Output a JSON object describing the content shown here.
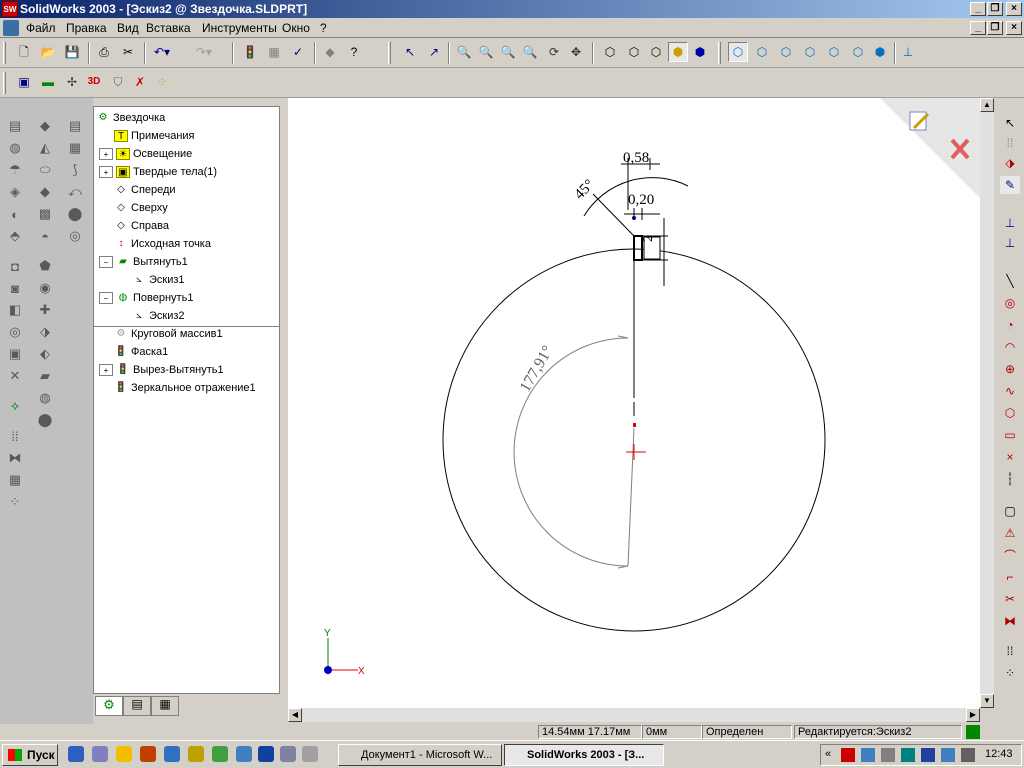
{
  "app": {
    "title": "SolidWorks 2003 - [Эскиз2 @ Звездочка.SLDPRT]",
    "icon_text": "SW"
  },
  "menu": [
    "Файл",
    "Правка",
    "Вид",
    "Вставка",
    "Инструменты",
    "Окно",
    "?"
  ],
  "tree": {
    "root": "Звездочка",
    "items": [
      {
        "label": "Примечания",
        "icon": "annotation-icon"
      },
      {
        "label": "Освещение",
        "icon": "lighting-icon"
      },
      {
        "label": "Твердые тела(1)",
        "icon": "solid-bodies-icon"
      },
      {
        "label": "Спереди",
        "icon": "plane-icon"
      },
      {
        "label": "Сверху",
        "icon": "plane-icon"
      },
      {
        "label": "Справа",
        "icon": "plane-icon"
      },
      {
        "label": "Исходная точка",
        "icon": "origin-icon"
      },
      {
        "label": "Вытянуть1",
        "icon": "extrude-icon"
      },
      {
        "label": "Эскиз1",
        "icon": "sketch-icon"
      },
      {
        "label": "Повернуть1",
        "icon": "revolve-icon"
      },
      {
        "label": "Эскиз2",
        "icon": "sketch-icon"
      },
      {
        "label": "Круговой массив1",
        "icon": "circular-pattern-icon"
      },
      {
        "label": "Фаска1",
        "icon": "chamfer-icon"
      },
      {
        "label": "Вырез-Вытянуть1",
        "icon": "cut-extrude-icon"
      },
      {
        "label": "Зеркальное отражение1",
        "icon": "mirror-icon"
      }
    ]
  },
  "sketch": {
    "dims": {
      "width_top": "0,58",
      "width_mid": "0,20",
      "height": "2",
      "angle_small": "45°",
      "angle_big": "177,91°"
    },
    "axes": {
      "x": "X",
      "y": "Y"
    }
  },
  "status": {
    "coords": "14.54мм 17.17мм",
    "z": "0мм",
    "state": "Определен",
    "editing": "Редактируется:Эскиз2"
  },
  "taskbar": {
    "start": "Пуск",
    "tasks": [
      "Документ1 - Microsoft W...",
      "SolidWorks 2003 - [З..."
    ],
    "clock": "12:43",
    "chevron": "«"
  },
  "colors": {
    "titlebar": "#0a246a",
    "canvas": "#ffffff",
    "dimension": "#000000",
    "sketch_red": "#e00000",
    "axis_y": "#008000",
    "axis_x": "#e00000"
  }
}
